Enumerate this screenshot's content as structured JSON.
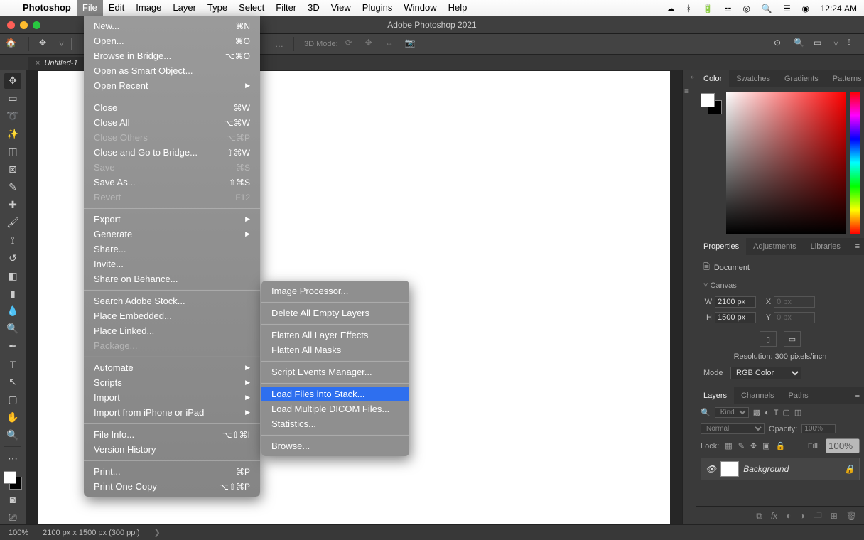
{
  "menubar": {
    "app": "Photoshop",
    "items": [
      "File",
      "Edit",
      "Image",
      "Layer",
      "Type",
      "Select",
      "Filter",
      "3D",
      "View",
      "Plugins",
      "Window",
      "Help"
    ],
    "active": 1,
    "clock": "12:24 AM"
  },
  "window": {
    "title": "Adobe Photoshop 2021"
  },
  "optbar": {
    "mode_label": "3D Mode:"
  },
  "tab": {
    "name": "Untitled-1",
    "close": "×"
  },
  "file_menu": [
    {
      "t": "New...",
      "s": "⌘N"
    },
    {
      "t": "Open...",
      "s": "⌘O"
    },
    {
      "t": "Browse in Bridge...",
      "s": "⌥⌘O"
    },
    {
      "t": "Open as Smart Object..."
    },
    {
      "t": "Open Recent",
      "arrow": true
    },
    {
      "div": true
    },
    {
      "t": "Close",
      "s": "⌘W"
    },
    {
      "t": "Close All",
      "s": "⌥⌘W"
    },
    {
      "t": "Close Others",
      "s": "⌥⌘P",
      "dis": true
    },
    {
      "t": "Close and Go to Bridge...",
      "s": "⇧⌘W"
    },
    {
      "t": "Save",
      "s": "⌘S",
      "dis": true
    },
    {
      "t": "Save As...",
      "s": "⇧⌘S"
    },
    {
      "t": "Revert",
      "s": "F12",
      "dis": true
    },
    {
      "div": true
    },
    {
      "t": "Export",
      "arrow": true
    },
    {
      "t": "Generate",
      "arrow": true
    },
    {
      "t": "Share..."
    },
    {
      "t": "Invite..."
    },
    {
      "t": "Share on Behance..."
    },
    {
      "div": true
    },
    {
      "t": "Search Adobe Stock..."
    },
    {
      "t": "Place Embedded..."
    },
    {
      "t": "Place Linked..."
    },
    {
      "t": "Package...",
      "dis": true
    },
    {
      "div": true
    },
    {
      "t": "Automate",
      "arrow": true
    },
    {
      "t": "Scripts",
      "arrow": true,
      "hl": false
    },
    {
      "t": "Import",
      "arrow": true
    },
    {
      "t": "Import from iPhone or iPad",
      "arrow": true
    },
    {
      "div": true
    },
    {
      "t": "File Info...",
      "s": "⌥⇧⌘I"
    },
    {
      "t": "Version History"
    },
    {
      "div": true
    },
    {
      "t": "Print...",
      "s": "⌘P"
    },
    {
      "t": "Print One Copy",
      "s": "⌥⇧⌘P"
    }
  ],
  "scripts_menu": [
    {
      "t": "Image Processor..."
    },
    {
      "div": true
    },
    {
      "t": "Delete All Empty Layers"
    },
    {
      "div": true
    },
    {
      "t": "Flatten All Layer Effects"
    },
    {
      "t": "Flatten All Masks"
    },
    {
      "div": true
    },
    {
      "t": "Script Events Manager..."
    },
    {
      "div": true
    },
    {
      "t": "Load Files into Stack...",
      "hl": true
    },
    {
      "t": "Load Multiple DICOM Files..."
    },
    {
      "t": "Statistics..."
    },
    {
      "div": true
    },
    {
      "t": "Browse..."
    }
  ],
  "panels": {
    "color_tabs": [
      "Color",
      "Swatches",
      "Gradients",
      "Patterns"
    ],
    "prop_tabs": [
      "Properties",
      "Adjustments",
      "Libraries"
    ],
    "prop": {
      "doc": "Document",
      "canvas": "Canvas",
      "W": "2100 px",
      "H": "1500 px",
      "X": "0 px",
      "Y": "0 px",
      "Wl": "W",
      "Hl": "H",
      "Xl": "X",
      "Yl": "Y",
      "res": "Resolution: 300 pixels/inch",
      "mode_l": "Mode",
      "mode": "RGB Color"
    },
    "layer_tabs": [
      "Layers",
      "Channels",
      "Paths"
    ],
    "layers": {
      "filter": "Kind",
      "blend": "Normal",
      "opacity_l": "Opacity:",
      "opacity": "100%",
      "lock_l": "Lock:",
      "fill_l": "Fill:",
      "fill": "100%",
      "name": "Background"
    }
  },
  "status": {
    "zoom": "100%",
    "dims": "2100 px x 1500 px (300 ppi)",
    "ar": "❯"
  },
  "tooltips": {
    "home": "🏠",
    "move": "✥",
    "search": "🔍",
    "square": "▭"
  }
}
